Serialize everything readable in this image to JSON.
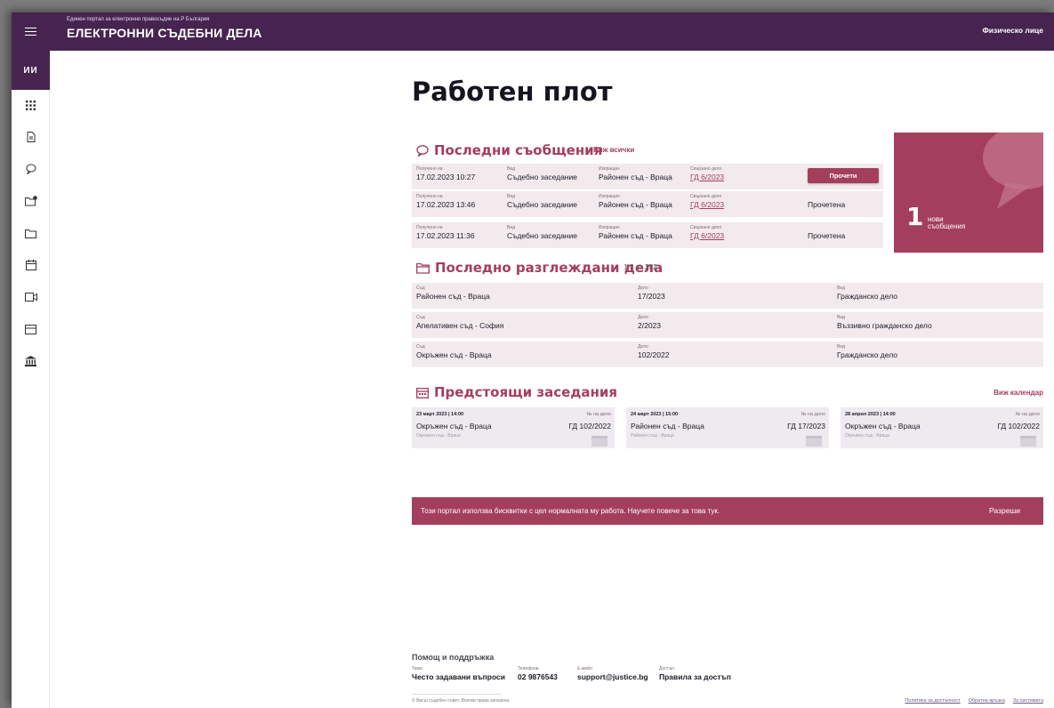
{
  "header": {
    "portal_subtitle": "Единен портал за електронно правосъдие на Р България",
    "portal_title": "ЕЛЕКТРОННИ СЪДЕБНИ ДЕЛА",
    "user_type": "Физическо лице"
  },
  "sidebar": {
    "avatar_initials": "ИИ",
    "icons": [
      "grid-icon",
      "document-icon",
      "chat-icon",
      "folder-new-icon",
      "folder-icon",
      "calendar-icon",
      "video-icon",
      "card-icon",
      "institution-icon"
    ]
  },
  "page": {
    "title": "Работен плот"
  },
  "messages": {
    "title": "Последни съобщения",
    "see_all": "Виж всички",
    "labels": {
      "received": "Получено на",
      "type": "Вид",
      "sender": "Изпращач",
      "case": "Свързано дело"
    },
    "read_button": "Прочети",
    "rows": [
      {
        "received": "17.02.2023 10:27",
        "type": "Съдебно заседание",
        "sender": "Районен съд - Враца",
        "case": "ГД 6/2023",
        "status": ""
      },
      {
        "received": "17.02.2023 13:46",
        "type": "Съдебно заседание",
        "sender": "Районен съд - Враца",
        "case": "ГД 6/2023",
        "status": "Прочетена"
      },
      {
        "received": "17.02.2023 11:36",
        "type": "Съдебно заседание",
        "sender": "Районен съд - Враца",
        "case": "ГД 6/2023",
        "status": "Прочетена"
      }
    ],
    "new_count": "1",
    "new_label": "нови съобщения"
  },
  "recent_cases": {
    "title": "Последно разглеждани дела",
    "count_note": "1-3 от 292",
    "labels": {
      "court": "Съд",
      "case": "Дело",
      "type": "Вид"
    },
    "rows": [
      {
        "court": "Районен съд - Враца",
        "case": "17/2023",
        "type": "Гражданско дело"
      },
      {
        "court": "Апелативен съд - София",
        "case": "2/2023",
        "type": "Въззивно гражданско дело"
      },
      {
        "court": "Окръжен съд - Враца",
        "case": "102/2022",
        "type": "Гражданско дело"
      }
    ]
  },
  "hearings": {
    "title": "Предстоящи заседания",
    "see_calendar": "Виж календар",
    "case_no_label": "№ на дело",
    "items": [
      {
        "date": "23 март 2023 | 14:00",
        "court": "Окръжен съд - Враца",
        "case": "ГД 102/2022",
        "court_small": "Окръжен съд - Враца"
      },
      {
        "date": "24 март 2023 | 15:00",
        "court": "Районен съд - Враца",
        "case": "ГД 17/2023",
        "court_small": "Районен съд - Враца"
      },
      {
        "date": "28 април 2023 | 14:00",
        "court": "Окръжен съд - Враца",
        "case": "ГД 102/2022",
        "court_small": "Окръжен съд - Враца"
      }
    ]
  },
  "cookie": {
    "text": "Този портал използва бисквитки с цел нормалната му работа. Научете повече за това тук.",
    "accept": "Разреши"
  },
  "footer": {
    "title": "Помощ и поддръжка",
    "columns": [
      {
        "label": "Теми",
        "value": "Често задавани въпроси"
      },
      {
        "label": "Телефони",
        "value": "02 9876543"
      },
      {
        "label": "E-мейл",
        "value": "support@justice.bg"
      },
      {
        "label": "Достъп",
        "value": "Правила за достъп"
      }
    ],
    "copyright": "© Висш съдебен съвет. Всички права запазени.",
    "links": [
      "Политика за достъпност",
      "Обратна връзка",
      "За системата"
    ]
  },
  "colors": {
    "brand": "#46244f",
    "accent": "#a43e5d",
    "row_bg": "#f3eaee"
  }
}
